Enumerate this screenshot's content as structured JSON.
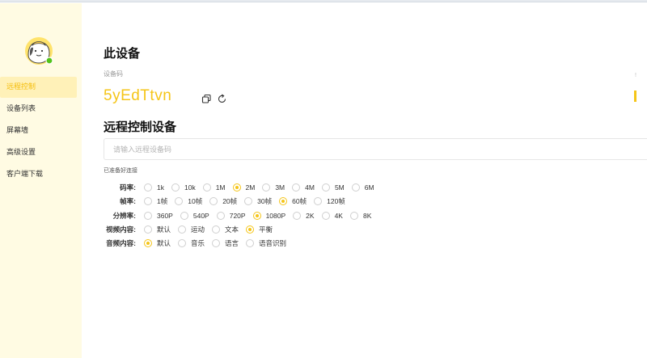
{
  "sidebar": {
    "items": [
      {
        "label": "远程控制",
        "active": true
      },
      {
        "label": "设备列表",
        "active": false
      },
      {
        "label": "屏幕墙",
        "active": false
      },
      {
        "label": "高级设置",
        "active": false
      },
      {
        "label": "客户端下载",
        "active": false
      }
    ]
  },
  "main": {
    "this_device_title": "此设备",
    "device_code_label": "设备码",
    "device_code": "5yEdTtvn",
    "remote_title": "远程控制设备",
    "remote_input_placeholder": "请输入远程设备码",
    "remote_input_value": "",
    "status_text": "已准备好连接"
  },
  "options": [
    {
      "label": "码率:",
      "items": [
        "1k",
        "10k",
        "1M",
        "2M",
        "3M",
        "4M",
        "5M",
        "6M"
      ],
      "selected": "2M"
    },
    {
      "label": "帧率:",
      "items": [
        "1帧",
        "10帧",
        "20帧",
        "30帧",
        "60帧",
        "120帧"
      ],
      "selected": "60帧"
    },
    {
      "label": "分辨率:",
      "items": [
        "360P",
        "540P",
        "720P",
        "1080P",
        "2K",
        "4K",
        "8K"
      ],
      "selected": "1080P"
    },
    {
      "label": "视频内容:",
      "items": [
        "默认",
        "运动",
        "文本",
        "平衡"
      ],
      "selected": "平衡"
    },
    {
      "label": "音频内容:",
      "items": [
        "默认",
        "音乐",
        "语言",
        "语音识别"
      ],
      "selected": "默认"
    }
  ],
  "colors": {
    "accent": "#f5c518",
    "sidebar_bg": "#fffbe3",
    "online_dot": "#52c41a"
  }
}
